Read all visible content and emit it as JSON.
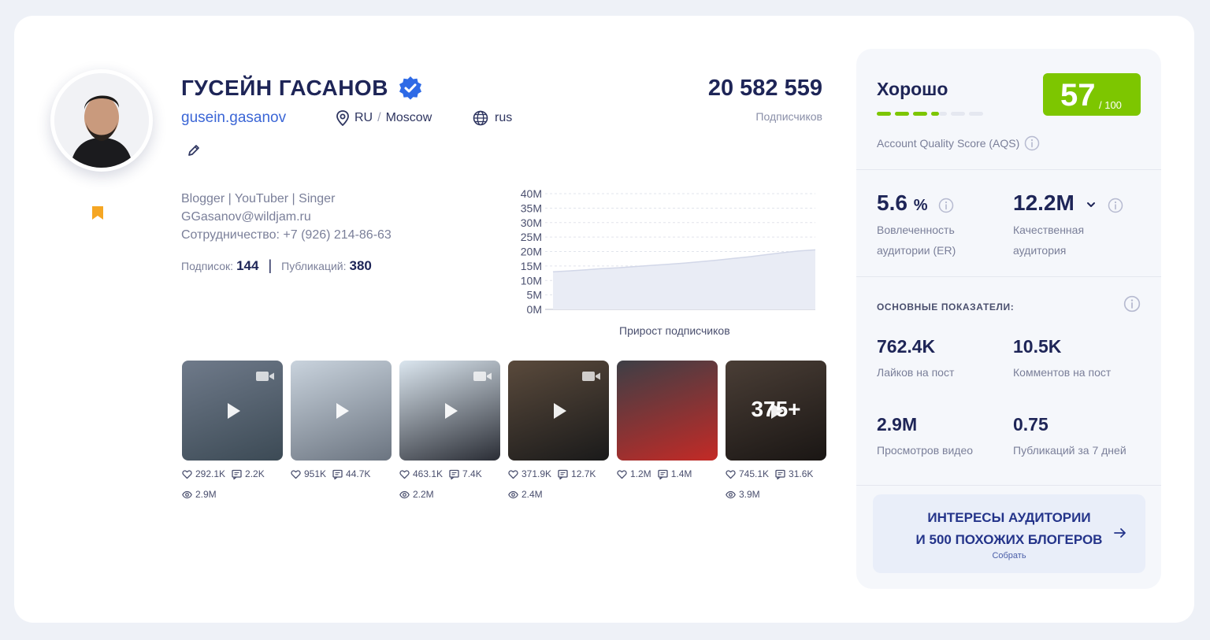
{
  "profile": {
    "name": "ГУСЕЙН ГАСАНОВ",
    "handle": "gusein.gasanov",
    "country": "RU",
    "city": "Moscow",
    "language": "rus",
    "subscribers_count": "20 582 559",
    "subscribers_label": "Подписчиков",
    "bio_lines": [
      "Blogger | YouTuber | Singer",
      "GGasanov@wildjam.ru",
      "Сотрудничество: +7 (926) 214-86-63"
    ],
    "following_label": "Подписок:",
    "following_value": "144",
    "posts_label": "Публикаций:",
    "posts_value": "380"
  },
  "chart_data": {
    "type": "area",
    "title": "Прирост подписчиков",
    "y_ticks": [
      "40M",
      "35M",
      "30M",
      "25M",
      "20M",
      "15M",
      "10M",
      "5M",
      "0M"
    ],
    "ylim": [
      0,
      40000000
    ],
    "values": [
      13000000,
      13300000,
      13700000,
      14100000,
      14400000,
      14800000,
      15200000,
      15600000,
      16000000,
      16500000,
      17000000,
      17600000,
      18200000,
      18900000,
      19600000,
      20200000,
      20582559
    ],
    "grid": true
  },
  "posts": [
    {
      "likes": "292.1K",
      "comments": "2.2K",
      "views": "2.9M",
      "color1": "#6f7a8a",
      "color2": "#3c4a55"
    },
    {
      "likes": "951K",
      "comments": "44.7K",
      "views": "",
      "color1": "#c9d3dd",
      "color2": "#6b7480"
    },
    {
      "likes": "463.1K",
      "comments": "7.4K",
      "views": "2.2M",
      "color1": "#dbe6ef",
      "color2": "#2a2d35"
    },
    {
      "likes": "371.9K",
      "comments": "12.7K",
      "views": "2.4M",
      "color1": "#5a4a3c",
      "color2": "#1a1a1a"
    },
    {
      "likes": "1.2M",
      "comments": "1.4M",
      "views": "",
      "color1": "#3d3f46",
      "color2": "#c42a26"
    },
    {
      "likes": "745.1K",
      "comments": "31.6K",
      "views": "3.9M",
      "color1": "#4a3e36",
      "color2": "#1a1614",
      "more": "375+"
    }
  ],
  "quality": {
    "rating_label": "Хорошо",
    "score": "57",
    "score_max": "/ 100",
    "aqs_label": "Account Quality Score (AQS)",
    "bar_filled": 3.5,
    "bar_total": 6
  },
  "metrics": {
    "er_value": "5.6",
    "er_unit": "%",
    "er_label_1": "Вовлеченность",
    "er_label_2": "аудитории (ER)",
    "qa_value": "12.2M",
    "qa_label_1": "Качественная",
    "qa_label_2": "аудитория"
  },
  "key": {
    "title": "ОСНОВНЫЕ ПОКАЗАТЕЛИ:",
    "likes_value": "762.4K",
    "likes_label": "Лайков на пост",
    "comments_value": "10.5K",
    "comments_label": "Комментов на пост",
    "views_value": "2.9M",
    "views_label": "Просмотров видео",
    "pubs_value": "0.75",
    "pubs_label": "Публикаций за 7 дней"
  },
  "cta": {
    "line1": "ИНТЕРЕСЫ АУДИТОРИИ",
    "line2": "И 500 ПОХОЖИХ БЛОГЕРОВ",
    "sub": "Собрать"
  },
  "colors": {
    "accent_green": "#7dc600",
    "brand_blue": "#3b66d6",
    "bookmark": "#f5a623"
  }
}
